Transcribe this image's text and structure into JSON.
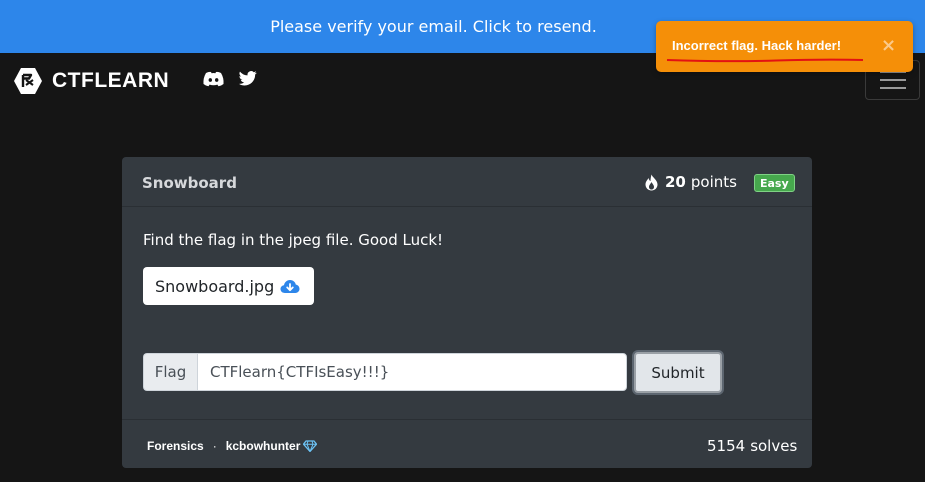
{
  "banner": {
    "verify_text": "Please verify your email. Click to resend."
  },
  "navbar": {
    "brand": "CTFLEARN"
  },
  "toast": {
    "message": "Incorrect flag. Hack harder!",
    "close_glyph": "×"
  },
  "challenge": {
    "title": "Snowboard",
    "points": "20",
    "points_label": "points",
    "difficulty": "Easy",
    "description": "Find the flag in the jpeg file. Good Luck!",
    "file_name": "Snowboard.jpg",
    "flag_label": "Flag",
    "flag_value": "CTFlearn{CTFIsEasy!!!}",
    "submit_label": "Submit",
    "category": "Forensics",
    "separator": "·",
    "author": "kcbowhunter",
    "solves_count": "5154",
    "solves_label": "solves"
  },
  "colors": {
    "banner_bg": "#2d86ea",
    "toast_bg": "#f58f08",
    "card_bg": "#343a40",
    "page_bg": "#151515",
    "easy_badge": "#46a84d"
  }
}
